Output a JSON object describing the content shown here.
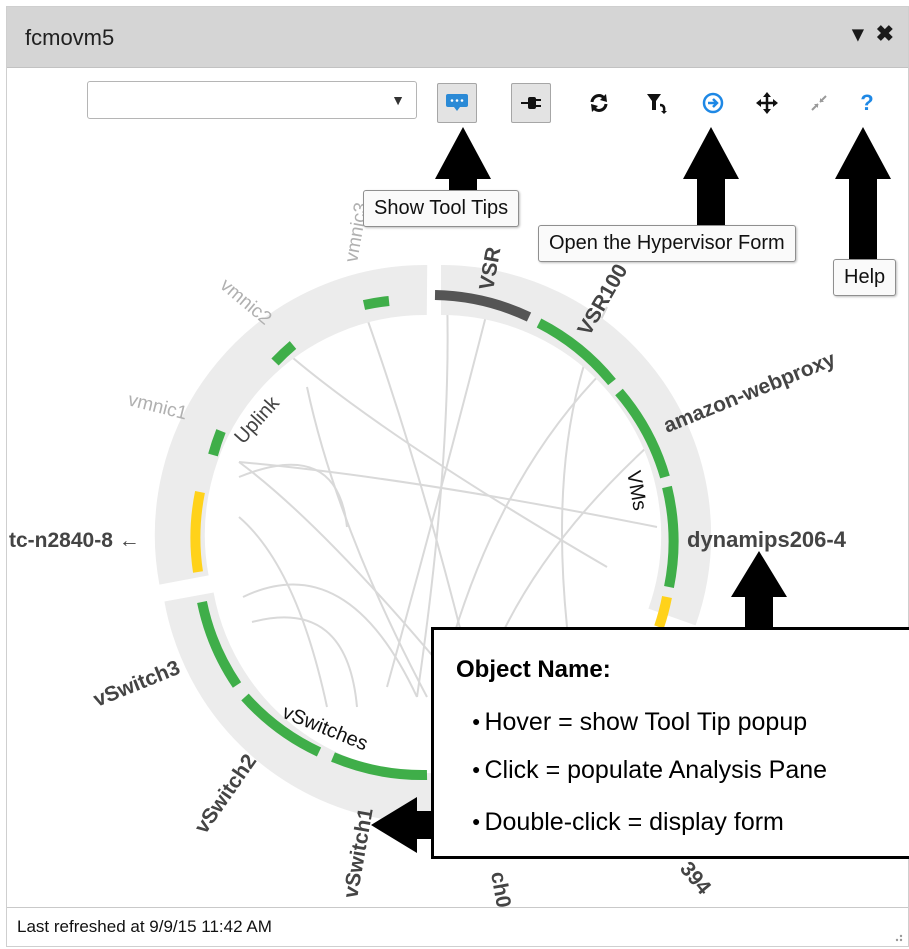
{
  "window": {
    "title": "fcmovm5",
    "menu_glyph": "▾",
    "close_glyph": "✖"
  },
  "toolbar": {
    "dropdown_value": "",
    "buttons": [
      {
        "name": "show-tooltips",
        "icon": "tooltip-icon"
      },
      {
        "name": "plug",
        "icon": "plug-icon"
      },
      {
        "name": "refresh",
        "icon": "refresh-icon"
      },
      {
        "name": "filter",
        "icon": "filter-icon"
      },
      {
        "name": "open-hypervisor-form",
        "icon": "open-form-icon"
      },
      {
        "name": "pan",
        "icon": "move-icon"
      },
      {
        "name": "collapse",
        "icon": "collapse-icon"
      },
      {
        "name": "help",
        "icon": "help-icon"
      }
    ]
  },
  "tooltips": {
    "show_tool_tips": "Show Tool Tips",
    "open_hypervisor_form": "Open the Hypervisor Form",
    "help": "Help"
  },
  "diagram": {
    "groups": {
      "uplink": "Uplink",
      "vms": "VMs",
      "vswitches": "vSwitches"
    },
    "nodes": {
      "vsr": "VSR",
      "vsr100": "VSR100",
      "amazon_webproxy": "amazon-webproxy",
      "dynamips": "dynamips206-4",
      "vmnic3": "vmnic3",
      "vmnic2": "vmnic2",
      "vmnic1": "vmnic1",
      "tc_n2840": "tc-n2840-8 ←",
      "vswitch3": "vSwitch3",
      "vswitch2": "vSwitch2",
      "vswitch1": "vSwitch1",
      "vswitch0": "ch0",
      "partial394": "394"
    },
    "colors": {
      "green": "#3fae49",
      "yellow": "#ffd21a",
      "dark": "#555555",
      "ring": "#ececec",
      "chord": "#d8d8d8"
    }
  },
  "callout": {
    "heading": "Object Name:",
    "lines": [
      "Hover = show Tool Tip popup",
      "Click = populate Analysis Pane",
      "Double-click = display form"
    ],
    "bullet": "●"
  },
  "status": {
    "last_refreshed": "Last refreshed at 9/9/15 11:42 AM"
  }
}
